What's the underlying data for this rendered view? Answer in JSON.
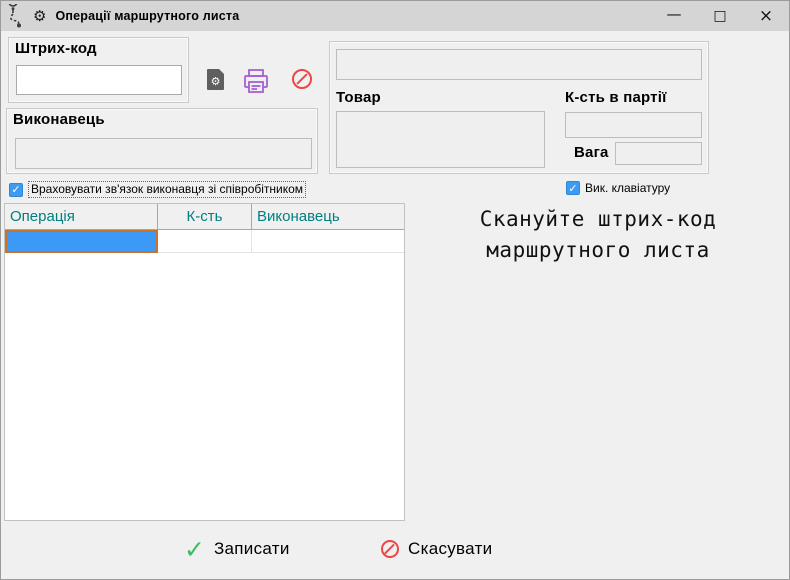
{
  "titlebar": {
    "title": "Операції маршрутного листа",
    "minimize": "—",
    "maximize": "□",
    "close": "×"
  },
  "icons": {
    "gear": "⚙",
    "check": "✓",
    "save_check": "✓"
  },
  "barcode": {
    "label": "Штрих-код",
    "value": ""
  },
  "executor": {
    "label": "Виконавець",
    "value": ""
  },
  "link_checkbox": {
    "label": "Враховувати зв'язок виконавця зі співробітником",
    "checked": true
  },
  "detail": {
    "scan_value": "",
    "product": {
      "label": "Товар",
      "value": ""
    },
    "batch_qty": {
      "label": "К-сть в партії",
      "value": ""
    },
    "weight": {
      "label": "Вага",
      "value": ""
    }
  },
  "keyboard_checkbox": {
    "label": "Вик. клавіатуру",
    "checked": true
  },
  "operations_table": {
    "headers": [
      "Операція",
      "К-сть",
      "Виконавець"
    ],
    "rows": []
  },
  "message": {
    "line1": "Скануйте штрих-код",
    "line2": "маршрутного листа"
  },
  "actions": {
    "save": "Записати",
    "cancel": "Скасувати"
  },
  "colors": {
    "table_header_text": "#008080",
    "selected_cell": "#3d99f6",
    "selected_cell_border": "#c8732a",
    "checkbox_blue": "#3d9bf2",
    "printer_purple": "#a55fd5",
    "cancel_red": "#ee4545",
    "save_green": "#3cbe5c",
    "titlebar_bg": "#d5d5d5",
    "window_bg": "#f0f0f0"
  }
}
